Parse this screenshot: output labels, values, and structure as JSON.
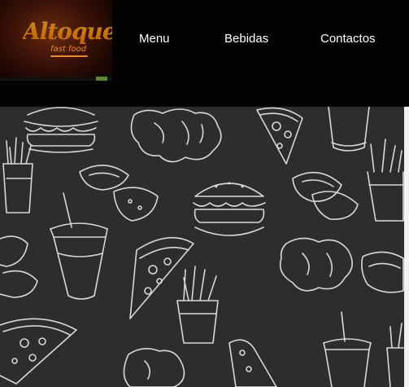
{
  "brand": {
    "name": "Altoque",
    "tagline": "fast food",
    "colors": {
      "accent": "#f08a10",
      "header_bg": "#030303",
      "hero_bg": "#2d2d2b"
    }
  },
  "nav": {
    "items": [
      {
        "label": "Menu"
      },
      {
        "label": "Bebidas"
      },
      {
        "label": "Contactos"
      }
    ]
  },
  "hero": {
    "pattern_icons": [
      "burger-icon",
      "fries-icon",
      "pizza-slice-icon",
      "soda-cup-icon",
      "chips-icon",
      "chicken-wing-icon"
    ]
  }
}
